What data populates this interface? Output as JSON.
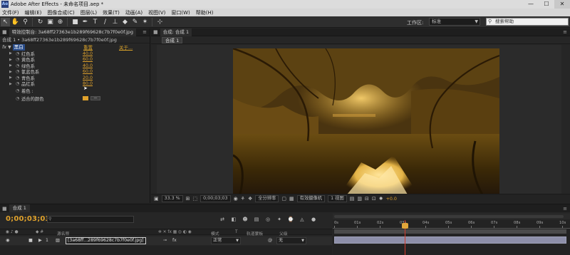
{
  "window": {
    "title": "Adobe After Effects - 未命名项目.aep *",
    "min_label": "—",
    "max_label": "☐",
    "close_label": "✕"
  },
  "menu": [
    "文件(F)",
    "编辑(E)",
    "图像合成(C)",
    "图层(L)",
    "效果(T)",
    "动画(A)",
    "视图(V)",
    "窗口(W)",
    "帮助(H)"
  ],
  "toolbar": {
    "workspace_label": "工作区:",
    "workspace_value": "标准",
    "search_placeholder": "搜索帮助"
  },
  "effect_controls": {
    "tab_label": "特效控制台: 3a68ff27363e1b289f69628c7b7f0e0f.jpg",
    "subhead": "合成 1 • 3a68ff27363e1b289f69628c7b7f0e0f.jpg",
    "effect_name": "黑白",
    "reset_label": "重置",
    "about_label": "关于...",
    "properties": [
      {
        "label": "红色系",
        "value": "40.0"
      },
      {
        "label": "黄色系",
        "value": "60.0"
      },
      {
        "label": "绿色系",
        "value": "40.0"
      },
      {
        "label": "氰蓝色系",
        "value": "60.0"
      },
      {
        "label": "青色系",
        "value": "20.0"
      },
      {
        "label": "品红系",
        "value": "80.0"
      }
    ],
    "tint_label": "着色 :",
    "tint_color_label": "适合的颜色",
    "tint_color_hex": "#e0a22c"
  },
  "composition": {
    "tab_label": "合成: 合成 1",
    "subtab_label": "合成 1",
    "zoom": "33.3 %",
    "timecode": "0;00;03;03",
    "resolution": "全分辨率",
    "camera": "有效摄像机",
    "views": "1 视图",
    "exposure": "+0.0"
  },
  "timeline": {
    "tab_label": "合成 1",
    "timecode": "0;00;03;03",
    "columns": {
      "source_name": "源名称",
      "switches": "模式",
      "trk": "T",
      "trkmat": "轨道蒙板",
      "parent": "父级"
    },
    "layer": {
      "index": "1",
      "name": "[3a68ff...289f69628c7b7f0e0f.jpg]",
      "mode": "正常",
      "parent": "无"
    },
    "ruler_labels": [
      "0s",
      "01s",
      "02s",
      "03s",
      "04s",
      "05s",
      "06s",
      "07s",
      "08s",
      "09s",
      "10s"
    ],
    "current_time_seconds": 3.1
  },
  "colors": {
    "accent": "#e0a22c",
    "cti": "#d43a2a",
    "layer_bar": "#8d8fa9",
    "selection": "#2a4d8a"
  }
}
